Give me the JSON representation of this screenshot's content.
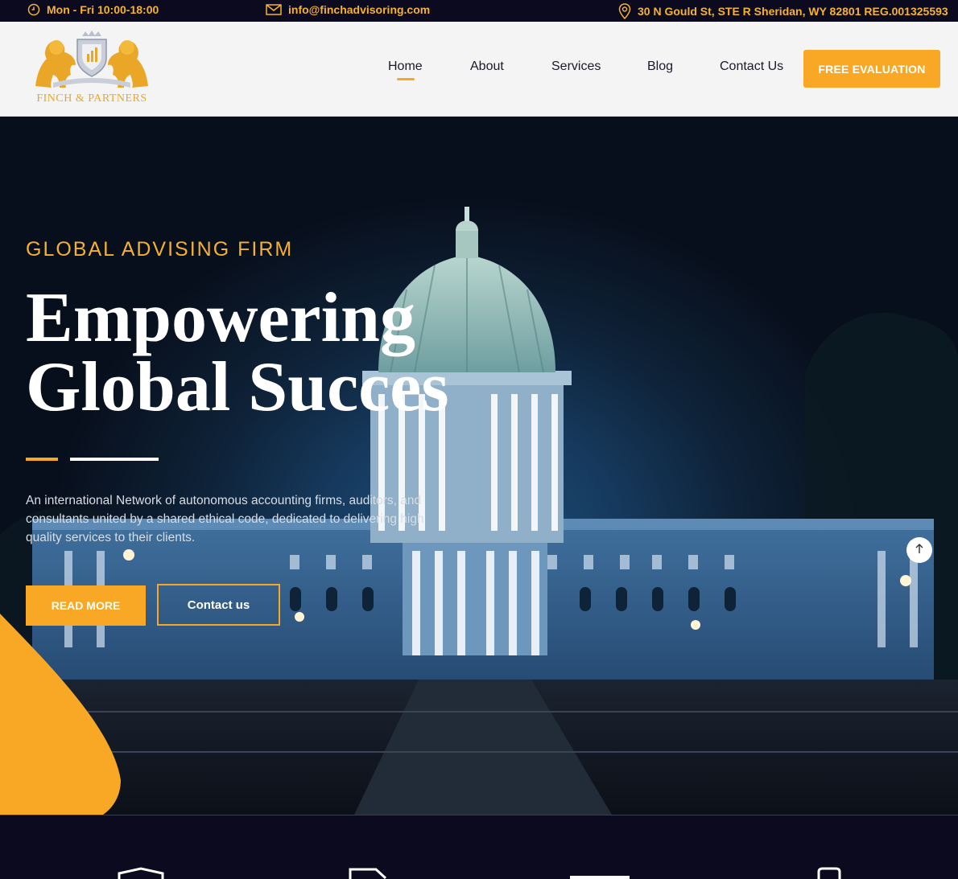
{
  "topbar": {
    "hours": "Mon - Fri 10:00-18:00",
    "email": "info@finchadvisoring.com",
    "address": "30 N Gould St, STE R Sheridan, WY 82801 REG.001325593"
  },
  "header": {
    "logo_text": "FINCH & PARTNERS",
    "nav": [
      "Home",
      "About",
      "Services",
      "Blog",
      "Contact Us"
    ],
    "active_nav": "Home",
    "cta_label": "FREE EVALUATION"
  },
  "hero": {
    "eyebrow": "GLOBAL ADVISING FIRM",
    "headline_line1": "Empowering",
    "headline_line2": "Global Succes",
    "intro": "An international Network of autonomous accounting firms, auditors, and consultants united by a shared ethical code, dedicated to delivering high quality services to their clients.",
    "read_more_label": "READ MORE",
    "contact_label": "Contact us"
  },
  "colors": {
    "accent": "#f9a825",
    "topbar_bg": "#0b0a1e",
    "header_bg": "#f4f4f4"
  },
  "icons": {
    "hours": "clock-icon",
    "email": "envelope-icon",
    "address": "map-pin-icon",
    "scroll_top": "arrow-up-icon"
  }
}
